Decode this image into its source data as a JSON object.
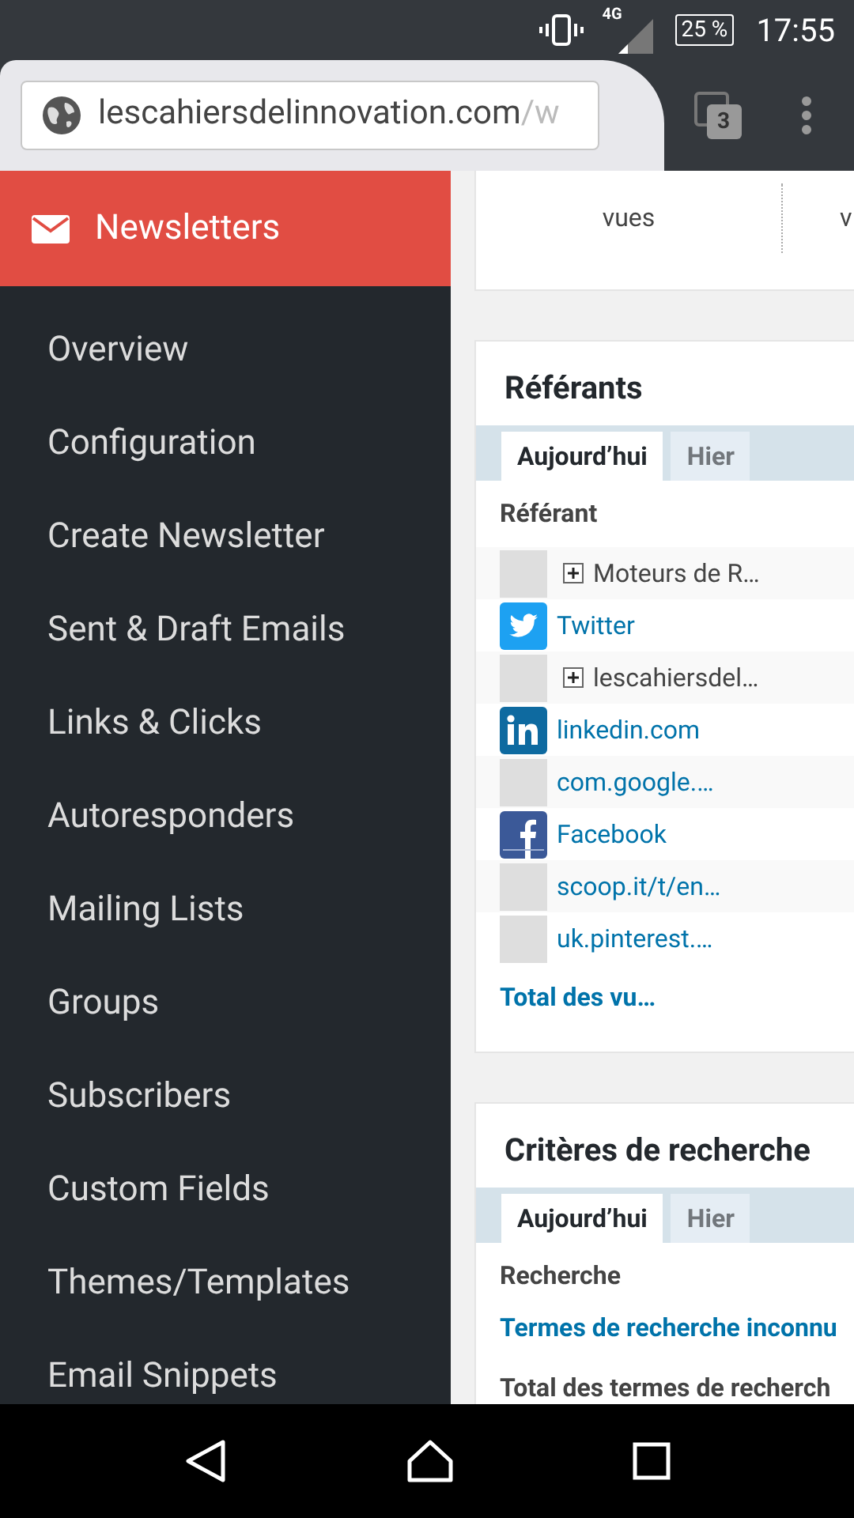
{
  "status_bar": {
    "network": "4G",
    "battery": "25 %",
    "time": "17:55"
  },
  "browser": {
    "url_host": "lescahiersdelinnovation.com",
    "url_path": "/w",
    "tab_count": "3"
  },
  "sidebar": {
    "header": "Newsletters",
    "items": [
      {
        "label": "Overview"
      },
      {
        "label": "Configuration"
      },
      {
        "label": "Create Newsletter"
      },
      {
        "label": "Sent & Draft Emails"
      },
      {
        "label": "Links & Clicks"
      },
      {
        "label": "Autoresponders"
      },
      {
        "label": "Mailing Lists"
      },
      {
        "label": "Groups"
      },
      {
        "label": "Subscribers"
      },
      {
        "label": "Custom Fields"
      },
      {
        "label": "Themes/Templates"
      },
      {
        "label": "Email Snippets"
      }
    ]
  },
  "views_card": {
    "columns": [
      "vues",
      "v"
    ]
  },
  "referrers": {
    "title": "Référants",
    "tabs": [
      {
        "label": "Aujourd’hui",
        "selected": true
      },
      {
        "label": "Hier",
        "selected": false
      }
    ],
    "column": "Référant",
    "rows": [
      {
        "kind": "group",
        "label": "Moteurs de R…"
      },
      {
        "kind": "twitter",
        "label": "Twitter"
      },
      {
        "kind": "group",
        "label": "lescahiersdel…"
      },
      {
        "kind": "linkedin",
        "label": "linkedin.com"
      },
      {
        "kind": "blank",
        "label": "com.google.…"
      },
      {
        "kind": "facebook",
        "label": "Facebook"
      },
      {
        "kind": "blank",
        "label": "scoop.it/t/en…"
      },
      {
        "kind": "blank",
        "label": "uk.pinterest.…"
      }
    ],
    "total": "Total des vu…"
  },
  "search": {
    "title": "Critères de recherche",
    "tabs": [
      {
        "label": "Aujourd’hui",
        "selected": true
      },
      {
        "label": "Hier",
        "selected": false
      }
    ],
    "column": "Recherche",
    "link": "Termes de recherche inconnu",
    "total": "Total des termes de recherch"
  }
}
